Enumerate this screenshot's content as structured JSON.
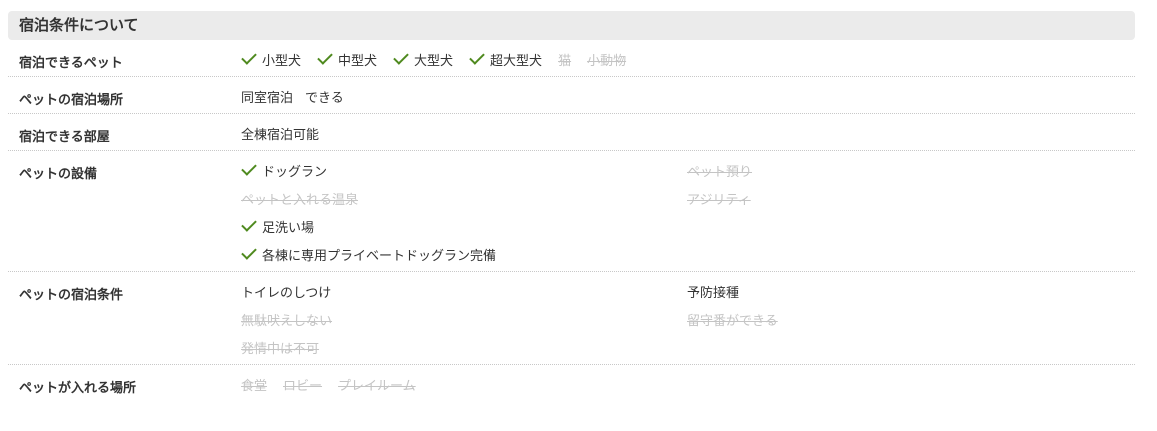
{
  "section_title": "宿泊条件について",
  "colors": {
    "check": "#4f8a1f",
    "header_bg": "#ebebeb",
    "disabled_text": "#c4c4c4"
  },
  "rows": [
    {
      "label": "宿泊できるペット",
      "items": [
        {
          "text": "小型犬",
          "available": true
        },
        {
          "text": "中型犬",
          "available": true
        },
        {
          "text": "大型犬",
          "available": true
        },
        {
          "text": "超大型犬",
          "available": true
        },
        {
          "text": "猫",
          "available": false
        },
        {
          "text": "小動物",
          "available": false
        }
      ]
    },
    {
      "label": "ペットの宿泊場所",
      "value_main": "同室宿泊",
      "value_sub": "できる"
    },
    {
      "label": "宿泊できる部屋",
      "value": "全棟宿泊可能"
    },
    {
      "label": "ペットの設備",
      "cells": [
        {
          "text": "ドッグラン",
          "available": true
        },
        {
          "text": "ペット預り",
          "available": false
        },
        {
          "text": "ペットと入れる温泉",
          "available": false
        },
        {
          "text": "アジリティ",
          "available": false
        },
        {
          "text": "足洗い場",
          "available": true
        },
        {
          "text": "",
          "available": null
        },
        {
          "text": "各棟に専用プライベートドッグラン完備",
          "available": true
        },
        {
          "text": "",
          "available": null
        }
      ]
    },
    {
      "label": "ペットの宿泊条件",
      "cells": [
        {
          "text": "トイレのしつけ",
          "available": true
        },
        {
          "text": "予防接種",
          "available": true
        },
        {
          "text": "無駄吠えしない",
          "available": false
        },
        {
          "text": "留守番ができる",
          "available": false
        },
        {
          "text": "発情中は不可",
          "available": false
        },
        {
          "text": "",
          "available": null
        }
      ]
    },
    {
      "label": "ペットが入れる場所",
      "items": [
        {
          "text": "食堂",
          "available": false
        },
        {
          "text": "ロビー",
          "available": false
        },
        {
          "text": "プレイルーム",
          "available": false
        }
      ]
    }
  ]
}
